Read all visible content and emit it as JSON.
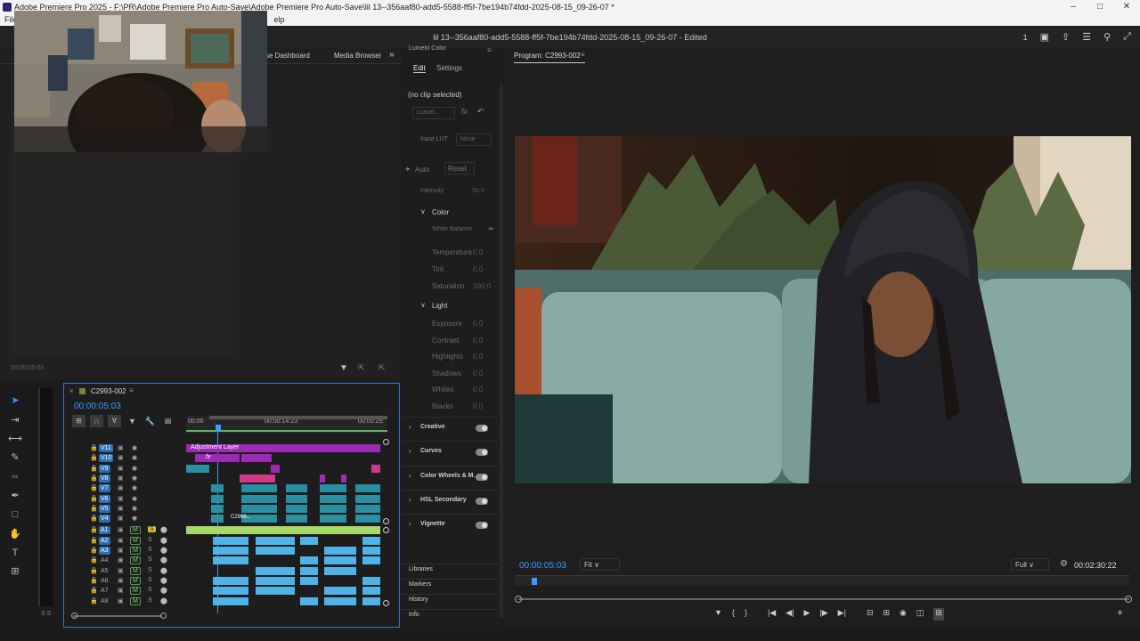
{
  "window": {
    "title": "Adobe Premiere Pro 2025 - F:\\PR\\Adobe Premiere Pro Auto-Save\\Adobe Premiere Pro Auto-Save\\lil 13--356aaf80-add5-5588-ff5f-7be194b74fdd-2025-08-15_09-26-07 *",
    "menu_first": "File",
    "menu_last": "elp"
  },
  "header": {
    "project_title": "lil 13--356aaf80-add5-5588-ff5f-7be194b74fdd-2025-08-15_09-26-07 - Edited",
    "count": "1"
  },
  "source_panel": {
    "tabs": [
      "se Dashboard",
      "Media Browser"
    ],
    "timecode": "00:00:05:03"
  },
  "lumetri": {
    "title": "Lumetri Color",
    "tabs": [
      "Edit",
      "Settings"
    ],
    "no_clip": "(no clip selected)",
    "preset": "Lumet...",
    "input_lut_label": "Input LUT",
    "input_lut_value": "None",
    "auto": "Auto",
    "reset": "Reset",
    "intensity_label": "Intensity",
    "intensity_value": "50.0",
    "color_section": "Color",
    "white_balance": "White Balance",
    "color_rows": [
      {
        "label": "Temperature",
        "value": "0.0"
      },
      {
        "label": "Tint",
        "value": "0.0"
      },
      {
        "label": "Saturation",
        "value": "100.0"
      }
    ],
    "light_section": "Light",
    "light_rows": [
      {
        "label": "Exposure",
        "value": "0.0"
      },
      {
        "label": "Contrast",
        "value": "0.0"
      },
      {
        "label": "Highlights",
        "value": "0.0"
      },
      {
        "label": "Shadows",
        "value": "0.0"
      },
      {
        "label": "Whites",
        "value": "0.0"
      },
      {
        "label": "Blacks",
        "value": "0.0"
      }
    ],
    "sections": [
      "Creative",
      "Curves",
      "Color Wheels & M...",
      "HSL Secondary",
      "Vignette"
    ],
    "bottom_tabs": [
      "Libraries",
      "Markers",
      "History",
      "Info"
    ]
  },
  "program": {
    "title": "Program: C2993-002",
    "timecode": "00:00:05:03",
    "fit": "Fit",
    "quality": "Full",
    "duration": "00:02:30:22"
  },
  "timeline": {
    "sequence": "C2993-002",
    "timecode": "00:00:05:03",
    "ruler": [
      "00:00",
      "00:00:14:23",
      "00:00:29:"
    ],
    "video_tracks": [
      "V11",
      "V10",
      "V9",
      "V8",
      "V7",
      "V6",
      "V5",
      "V4"
    ],
    "audio_tracks": [
      "A1",
      "A2",
      "A3",
      "A4",
      "A5",
      "A6",
      "A7",
      "A8"
    ],
    "adjustment_layer": "Adjustment Layer",
    "clip_label": "C2998...",
    "fx": "fx",
    "solo": "S",
    "mute": "M",
    "meter_label": "S S"
  },
  "colors": {
    "accent_blue": "#2d8ceb",
    "clip_purple": "#9b2bb5",
    "clip_magenta": "#d13a8a",
    "clip_teal": "#2a8fa0",
    "audio_blue": "#4fb3e8",
    "audio_green": "#a6d96a"
  }
}
